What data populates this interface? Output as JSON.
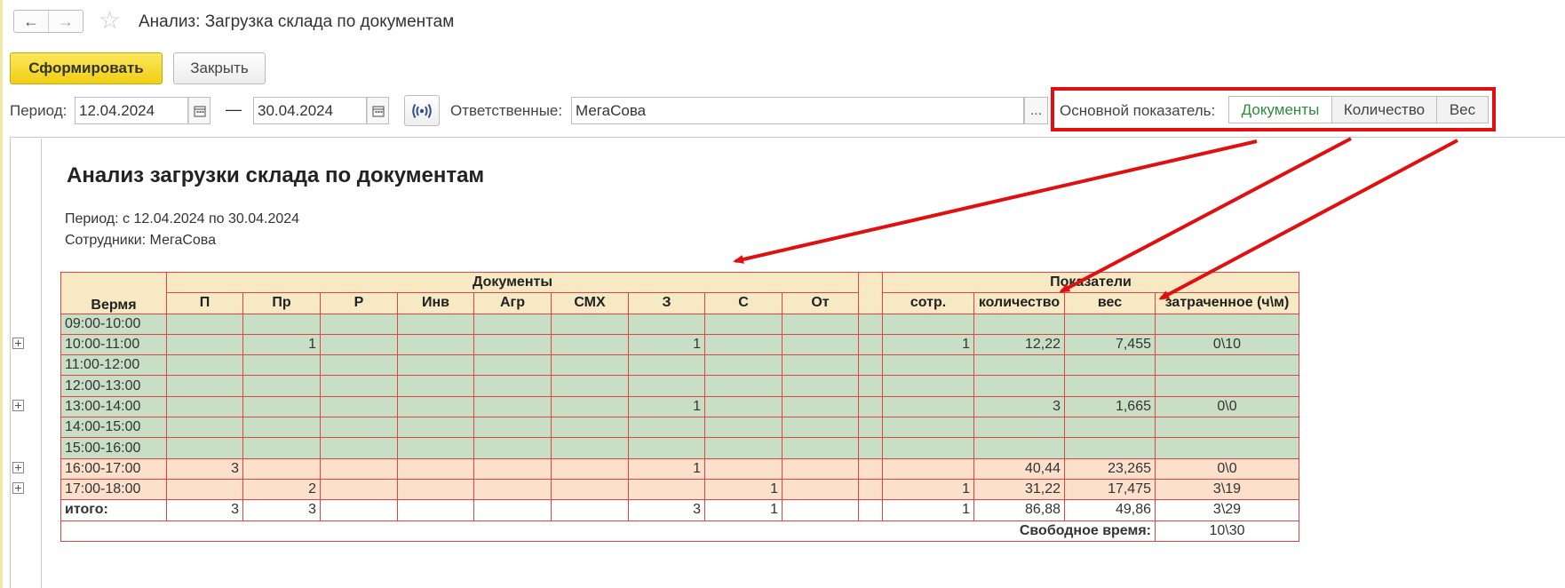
{
  "window": {
    "title": "Анализ: Загрузка склада по документам",
    "back_icon": "←",
    "forward_icon": "→",
    "star_icon": "☆"
  },
  "toolbar": {
    "generate_label": "Сформировать",
    "close_label": "Закрыть"
  },
  "filters": {
    "period_label": "Период:",
    "date_from": "12.04.2024",
    "date_separator": "—",
    "date_to": "30.04.2024",
    "responsible_label": "Ответственные:",
    "responsible_value": "МегаСова",
    "ellipsis": "...",
    "indicator_label": "Основной показатель:",
    "indicator_options": [
      "Документы",
      "Количество",
      "Вес"
    ],
    "indicator_selected": "Документы"
  },
  "report": {
    "title": "Анализ загрузки склада по документам",
    "period_line": "Период: с 12.04.2024 по 30.04.2024",
    "employees_line": "Сотрудники: МегаСова",
    "header_time": "Вермя",
    "header_documents": "Документы",
    "header_indicators": "Показатели",
    "doc_columns": [
      "П",
      "Пр",
      "Р",
      "Инв",
      "Агр",
      "СМХ",
      "З",
      "С",
      "От"
    ],
    "ind_columns": [
      "сотр.",
      "количество",
      "вес",
      "затраченное (ч\\м)"
    ],
    "rows": [
      {
        "time": "09:00-10:00",
        "docs": [
          "",
          "",
          "",
          "",
          "",
          "",
          "",
          "",
          ""
        ],
        "ind": [
          "",
          "",
          "",
          ""
        ]
      },
      {
        "time": "10:00-11:00",
        "docs": [
          "",
          "1",
          "",
          "",
          "",
          "",
          "1",
          "",
          ""
        ],
        "ind": [
          "1",
          "12,22",
          "7,455",
          "0\\10"
        ]
      },
      {
        "time": "11:00-12:00",
        "docs": [
          "",
          "",
          "",
          "",
          "",
          "",
          "",
          "",
          ""
        ],
        "ind": [
          "",
          "",
          "",
          ""
        ]
      },
      {
        "time": "12:00-13:00",
        "docs": [
          "",
          "",
          "",
          "",
          "",
          "",
          "",
          "",
          ""
        ],
        "ind": [
          "",
          "",
          "",
          ""
        ]
      },
      {
        "time": "13:00-14:00",
        "docs": [
          "",
          "",
          "",
          "",
          "",
          "",
          "1",
          "",
          ""
        ],
        "ind": [
          "",
          "3",
          "1,665",
          "0\\0"
        ]
      },
      {
        "time": "14:00-15:00",
        "docs": [
          "",
          "",
          "",
          "",
          "",
          "",
          "",
          "",
          ""
        ],
        "ind": [
          "",
          "",
          "",
          ""
        ]
      },
      {
        "time": "15:00-16:00",
        "docs": [
          "",
          "",
          "",
          "",
          "",
          "",
          "",
          "",
          ""
        ],
        "ind": [
          "",
          "",
          "",
          ""
        ]
      },
      {
        "time": "16:00-17:00",
        "docs": [
          "3",
          "",
          "",
          "",
          "",
          "",
          "1",
          "",
          ""
        ],
        "ind": [
          "",
          "40,44",
          "23,265",
          "0\\0"
        ]
      },
      {
        "time": "17:00-18:00",
        "docs": [
          "",
          "2",
          "",
          "",
          "",
          "",
          "",
          "1",
          ""
        ],
        "ind": [
          "1",
          "31,22",
          "17,475",
          "3\\19"
        ]
      }
    ],
    "total": {
      "label": "итого:",
      "docs": [
        "3",
        "3",
        "",
        "",
        "",
        "",
        "3",
        "1",
        ""
      ],
      "ind": [
        "1",
        "86,88",
        "49,86",
        "3\\29"
      ]
    },
    "free_time_label": "Свободное время:",
    "free_time_value": "10\\30"
  },
  "colors": {
    "accent_yellow": "#f1cf14",
    "header_bg": "#f7e9c4",
    "work_hours_bg": "#c8dfc6",
    "late_hours_bg": "#fce0cc",
    "grid_border": "#e04545",
    "annotation_red": "#e01010",
    "selected_green": "#2e8b3a"
  }
}
